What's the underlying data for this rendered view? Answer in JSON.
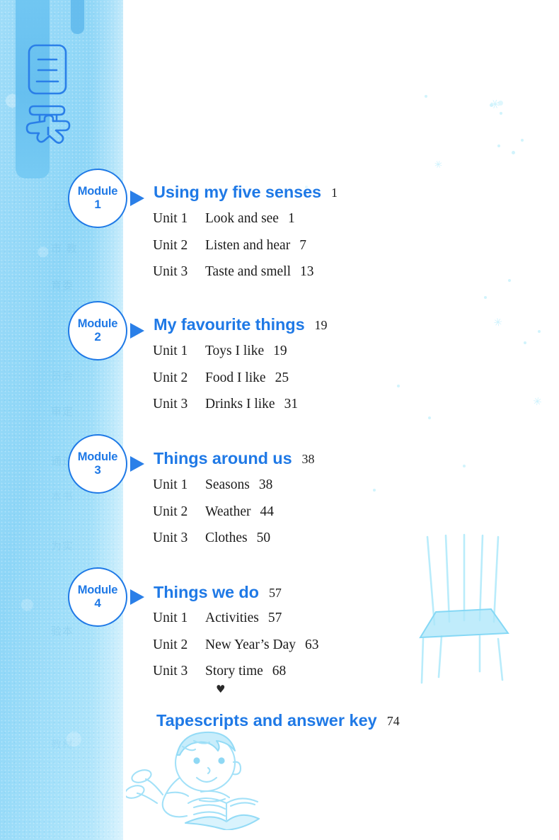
{
  "page": {
    "kind": "textbook-table-of-contents",
    "heading_cjk": "目录",
    "accent_color": "#1f79e6",
    "band_color": "#8ed6f7",
    "body_text_color": "#1c1c1c"
  },
  "modules": [
    {
      "badge_word": "Module",
      "badge_number": "1",
      "title": "Using my five senses",
      "page": "1",
      "units": [
        {
          "label": "Unit 1",
          "title": "Look and see",
          "page": "1"
        },
        {
          "label": "Unit 2",
          "title": "Listen and hear",
          "page": "7"
        },
        {
          "label": "Unit 3",
          "title": "Taste and smell",
          "page": "13"
        }
      ]
    },
    {
      "badge_word": "Module",
      "badge_number": "2",
      "title": "My favourite things",
      "page": "19",
      "units": [
        {
          "label": "Unit 1",
          "title": "Toys I like",
          "page": "19"
        },
        {
          "label": "Unit 2",
          "title": "Food I like",
          "page": "25"
        },
        {
          "label": "Unit 3",
          "title": "Drinks I like",
          "page": "31"
        }
      ]
    },
    {
      "badge_word": "Module",
      "badge_number": "3",
      "title": "Things around us",
      "page": "38",
      "units": [
        {
          "label": "Unit 1",
          "title": "Seasons",
          "page": "38"
        },
        {
          "label": "Unit 2",
          "title": "Weather",
          "page": "44"
        },
        {
          "label": "Unit 3",
          "title": "Clothes",
          "page": "50"
        }
      ]
    },
    {
      "badge_word": "Module",
      "badge_number": "4",
      "title": "Things we do",
      "page": "57",
      "units": [
        {
          "label": "Unit 1",
          "title": "Activities",
          "page": "57"
        },
        {
          "label": "Unit 2",
          "title": "New Year’s Day",
          "page": "63"
        },
        {
          "label": "Unit 3",
          "title": "Story time",
          "page": "68"
        }
      ]
    }
  ],
  "appendix": {
    "bullet": "♥",
    "title": "Tapescripts and answer key",
    "page": "74"
  },
  "decorations": {
    "ghost_text_lines": [
      "上海 ",
      "市 教",
      "育委",
      "员会",
      "审定",
      "通过",
      "本书",
      "为实",
      "验本",
      "教材"
    ],
    "illustrations": [
      {
        "name": "boy-reading-illustration"
      },
      {
        "name": "chair-sketch-illustration"
      },
      {
        "name": "cjk-contents-glyph-art"
      }
    ]
  }
}
